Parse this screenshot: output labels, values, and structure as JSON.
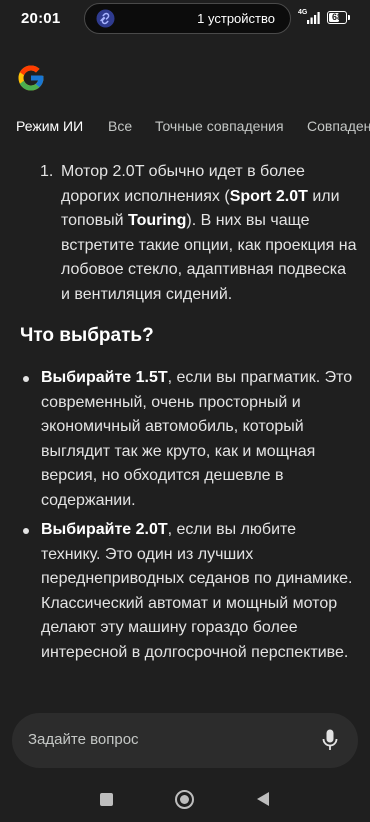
{
  "status_bar": {
    "time": "20:01",
    "pill_text": "1 устройство",
    "network": "4G",
    "battery": "68",
    "battery_level": 0.68
  },
  "tabs": [
    {
      "label": "Режим ИИ",
      "active": true
    },
    {
      "label": "Все",
      "active": false
    },
    {
      "label": "Точные совпадения",
      "active": false
    },
    {
      "label": "Совпадения",
      "active": false
    }
  ],
  "content": {
    "ordered_item": {
      "number": "1.",
      "text_1": "Мотор 2.0T обычно идет в более дорогих исполнениях (",
      "bold_1": "Sport 2.0T",
      "text_2": " или топовый ",
      "bold_2": "Touring",
      "text_3": "). В них вы чаще встретите такие опции, как проекция на лобовое стекло, адаптивная подвеска и вентиляция сидений."
    },
    "heading": "Что выбрать?",
    "bullets": [
      {
        "bold": "Выбирайте 1.5T",
        "text": ", если вы прагматик. Это современный, очень просторный и экономичный автомобиль, который выглядит так же круто, как и мощная версия, но обходится дешевле в содержании."
      },
      {
        "bold": "Выбирайте 2.0T",
        "text": ", если вы любите технику. Это один из лучших переднеприводных седанов по динамике. Классический автомат и мощный мотор делают эту машину гораздо более интересной в долгосрочной перспективе."
      }
    ]
  },
  "ask_bar": {
    "placeholder": "Задайте вопрос"
  },
  "colors": {
    "background": "#1f1f1f",
    "text": "#e3e3e3",
    "ask_bar": "#2c2c2c"
  }
}
